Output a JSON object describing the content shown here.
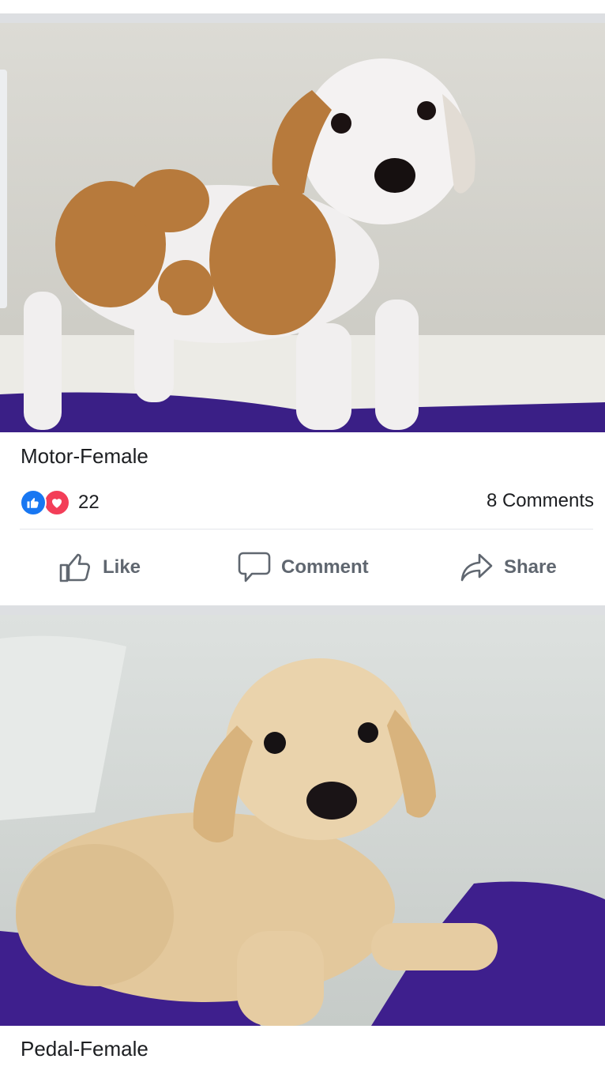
{
  "post1": {
    "caption": "Motor-Female",
    "reaction_icons": [
      "like-icon",
      "love-icon"
    ],
    "reaction_count": "22",
    "comments": "8 Comments"
  },
  "actions": {
    "like": "Like",
    "comment": "Comment",
    "share": "Share"
  },
  "post2": {
    "caption": "Pedal-Female"
  },
  "colors": {
    "like_blue": "#1877f2",
    "love_red": "#f33e58",
    "action_gray": "#606770",
    "separator": "#dddfe2",
    "blanket_purple": "#3f1f8f"
  }
}
